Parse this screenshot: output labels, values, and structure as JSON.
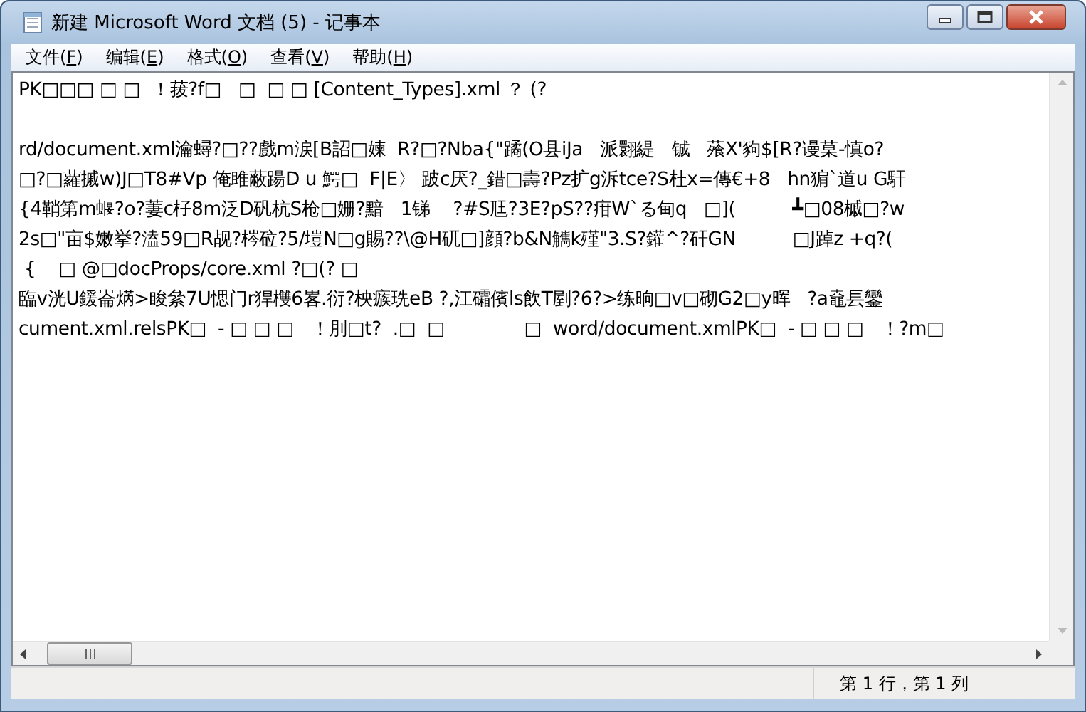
{
  "window": {
    "title": "新建 Microsoft Word 文档 (5) - 记事本"
  },
  "menu": [
    {
      "label": "文件(F)"
    },
    {
      "label": "编辑(E)"
    },
    {
      "label": "格式(O)"
    },
    {
      "label": "查看(V)"
    },
    {
      "label": "帮助(H)"
    }
  ],
  "editor": {
    "paragraphs": [
      [
        "PK□□□ □ □  ！菝?f□   □  □ □ [Content_Types].xml ？ (?"
      ],
      [
        "rd/document.xml瀹蟳?□??戲m涙[B詔□媡  R?□?Nba{\"蹫(O县iJa   派翾緹   铖   蕵X'豞$[R?谩菒-慎o?",
        "□?□蘿摵w)J□T8#Vp 俺雎蔽踼D u 鰐□  F|E〉 跛c厌?_錯□壽?Pz扩g泝tce?S杜x=傳€+8   hn猏`道u G馯",
        "{4鞘第m蝘?o?萋c杍8m泛D矾杭S枪□姗?黯   1锑    ?#S尫?3E?pS??疳W`る甸q   □](          ┻□08槭□?w",
        "2s□\"亩$嫩挙?溘59□R觇?梣砬?5/塏N□g賜??\\@H矹□]顔?b&N觽k殣\"3.S?鑵^?矸GN          □J踔z +q?(",
        " {    □ @□docProps/core.xml ?□(? □",
        "臨v洸U鍰崙焫>睃絫7U愢门r猂欆6畧.衍?柍瘯珗eB ?,江礵儐ls飲T剭?6?>练晌□v□砌G2□y晖   ?a鼀镸鑾",
        "cument.xml.relsPK□  - □ □ □   ！刖□t?  .□  □              □  word/document.xmlPK□  - □ □ □   ！?m□"
      ]
    ]
  },
  "status_bar": {
    "position": "第 1 行，第 1 列"
  }
}
